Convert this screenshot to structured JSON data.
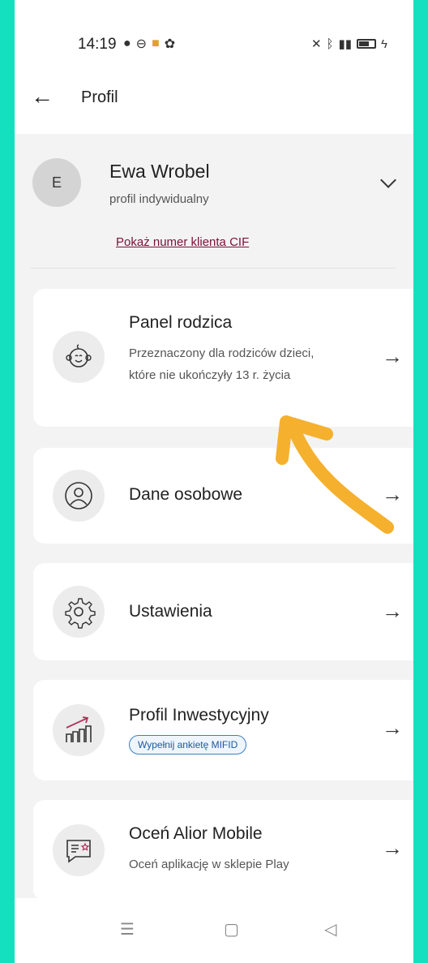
{
  "status_bar": {
    "time": "14:19"
  },
  "header": {
    "title": "Profil"
  },
  "user": {
    "initial": "E",
    "name": "Ewa Wrobel",
    "type": "profil indywidualny",
    "cif_link": "Pokaż numer klienta CIF"
  },
  "menu": [
    {
      "title": "Panel rodzica",
      "subtitle": "Przeznaczony dla rodziców dzieci, które nie ukończyły 13 r. życia",
      "icon": "baby-face-icon"
    },
    {
      "title": "Dane osobowe",
      "icon": "person-icon"
    },
    {
      "title": "Ustawienia",
      "icon": "gear-icon"
    },
    {
      "title": "Profil Inwestycyjny",
      "badge": "Wypełnij ankietę MIFID",
      "icon": "investment-chart-icon"
    },
    {
      "title": "Oceń Alior Mobile",
      "subtitle": "Oceń aplikację w sklepie Play",
      "icon": "rating-message-icon"
    }
  ],
  "colors": {
    "background": "#14e0c0",
    "link": "#7a1238",
    "badge": "#3b7fc4",
    "annotation_arrow": "#f5b02e"
  }
}
